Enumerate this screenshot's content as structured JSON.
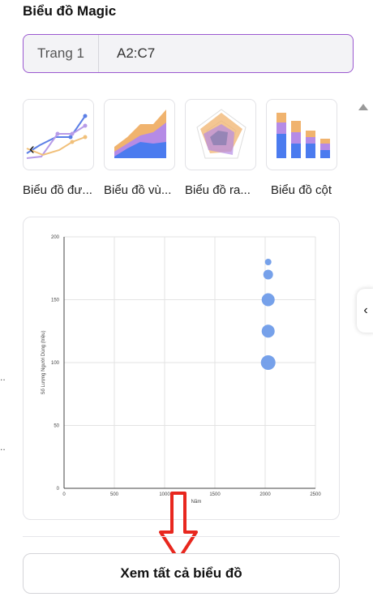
{
  "panel": {
    "title": "Biểu đồ Magic"
  },
  "range": {
    "sheet": "Trang 1",
    "cells": "A2:C7"
  },
  "thumbnails": [
    {
      "label": "Biểu đồ đư...",
      "icon": "line-chart-icon"
    },
    {
      "label": "Biểu đồ vù...",
      "icon": "area-chart-icon"
    },
    {
      "label": "Biểu đồ ra...",
      "icon": "radar-chart-icon"
    },
    {
      "label": "Biểu đồ cột",
      "icon": "stacked-bar-chart-icon"
    }
  ],
  "icons": {
    "carousel_prev": "‹",
    "side_tab": "‹"
  },
  "view_all_label": "Xem tất cả biểu đồ",
  "colors": {
    "accent": "#9b59d0",
    "bubble": "#6f9ce9",
    "arrow": "#e8271e"
  },
  "chart_data": {
    "type": "scatter",
    "xlabel": "Năm",
    "ylabel": "Số Lượng Người Dùng (triệu)",
    "xlim": [
      0,
      2500
    ],
    "ylim": [
      0,
      200
    ],
    "xticks": [
      "0",
      "500",
      "1000",
      "1500",
      "2000",
      "2500"
    ],
    "yticks": [
      "0",
      "50",
      "100",
      "150",
      "200"
    ],
    "grid": true,
    "points": [
      {
        "x": 2030,
        "y": 180,
        "size": 4
      },
      {
        "x": 2030,
        "y": 170,
        "size": 6
      },
      {
        "x": 2030,
        "y": 150,
        "size": 8
      },
      {
        "x": 2030,
        "y": 125,
        "size": 8
      },
      {
        "x": 2030,
        "y": 100,
        "size": 9
      }
    ]
  }
}
